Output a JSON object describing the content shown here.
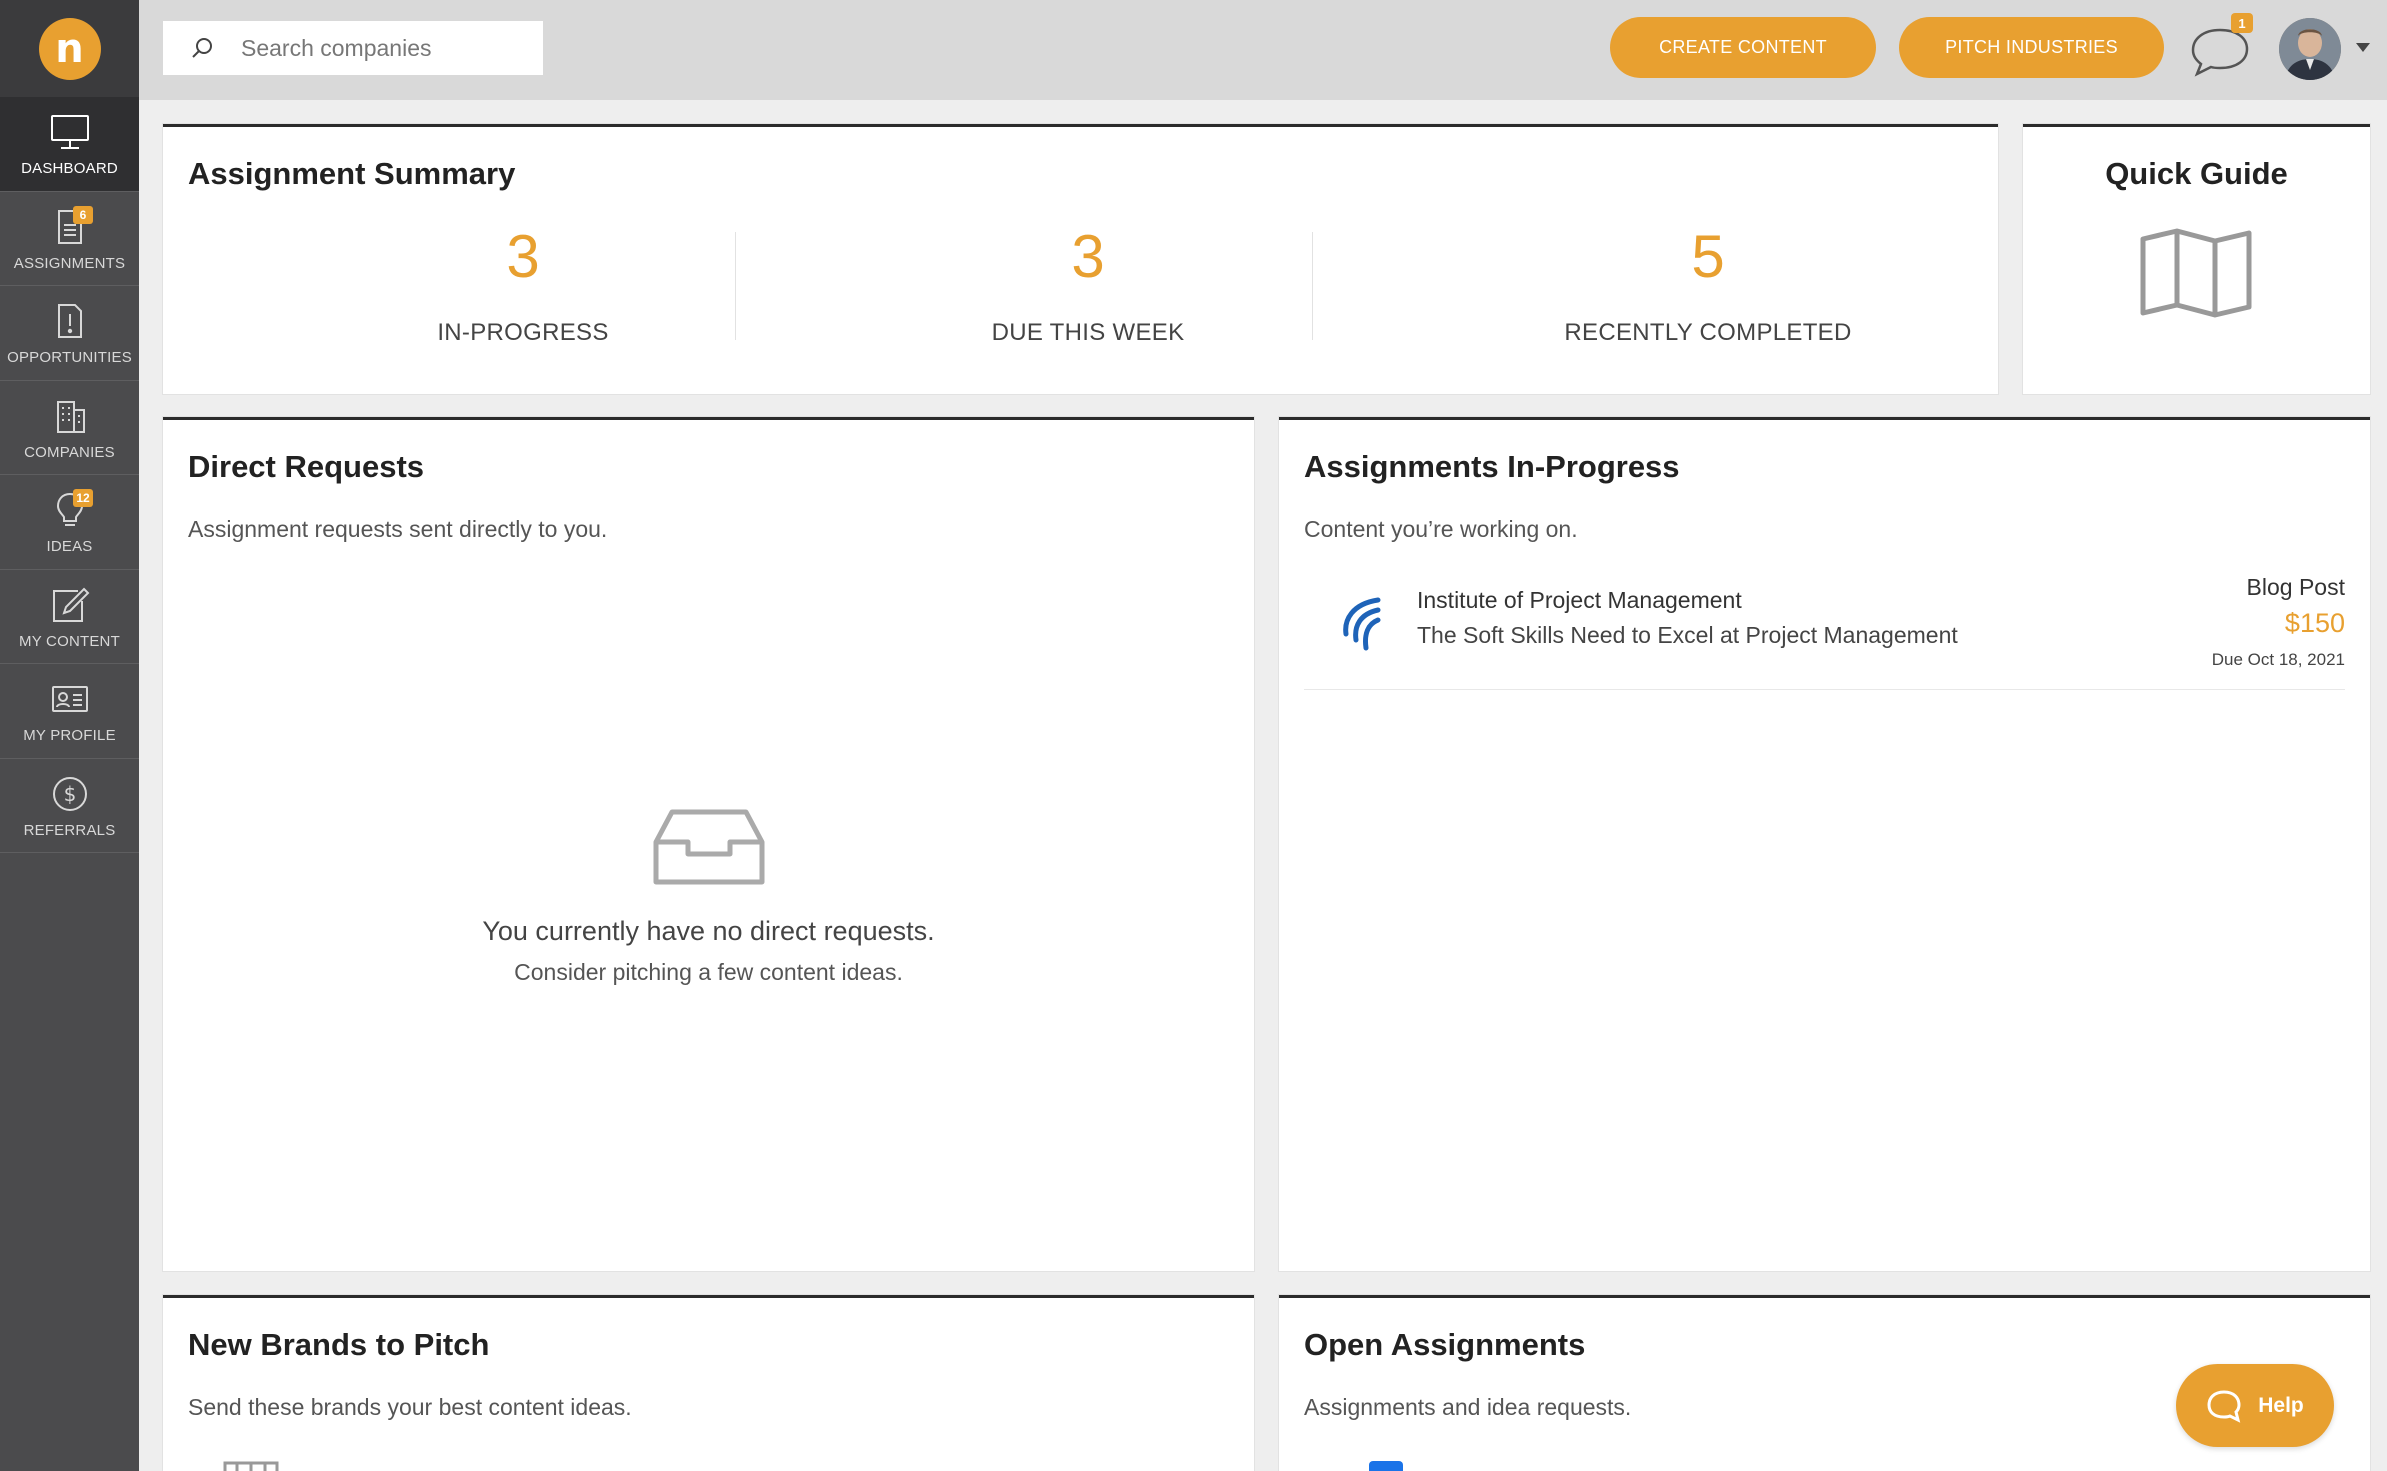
{
  "sidebar": {
    "logo_letter": "n",
    "items": [
      {
        "label": "DASHBOARD",
        "icon": "monitor-icon",
        "active": true
      },
      {
        "label": "ASSIGNMENTS",
        "icon": "document-list-icon",
        "badge": "6"
      },
      {
        "label": "OPPORTUNITIES",
        "icon": "document-alert-icon"
      },
      {
        "label": "COMPANIES",
        "icon": "building-icon"
      },
      {
        "label": "IDEAS",
        "icon": "lightbulb-icon",
        "badge": "12"
      },
      {
        "label": "MY CONTENT",
        "icon": "edit-icon"
      },
      {
        "label": "MY PROFILE",
        "icon": "id-card-icon"
      },
      {
        "label": "REFERRALS",
        "icon": "dollar-circle-icon"
      }
    ]
  },
  "topbar": {
    "search_placeholder": "Search companies",
    "create_label": "CREATE CONTENT",
    "pitch_label": "PITCH INDUSTRIES",
    "chat_badge": "1"
  },
  "summary": {
    "title": "Assignment Summary",
    "stats": [
      {
        "value": "3",
        "label": "IN-PROGRESS"
      },
      {
        "value": "3",
        "label": "DUE THIS WEEK"
      },
      {
        "value": "5",
        "label": "RECENTLY COMPLETED"
      }
    ]
  },
  "quick_guide": {
    "title": "Quick Guide"
  },
  "direct_requests": {
    "title": "Direct Requests",
    "subtitle": "Assignment requests sent directly to you.",
    "empty_main": "You currently have no direct requests.",
    "empty_sub": "Consider pitching a few content ideas."
  },
  "in_progress": {
    "title": "Assignments In-Progress",
    "subtitle": "Content you’re working on.",
    "items": [
      {
        "company": "Institute of Project Management",
        "name": "The Soft Skills Need to Excel at Project Management",
        "type": "Blog Post",
        "price": "$150",
        "due": "Due Oct 18, 2021"
      }
    ]
  },
  "new_brands": {
    "title": "New Brands to Pitch",
    "subtitle": "Send these brands your best content ideas."
  },
  "open_assignments": {
    "title": "Open Assignments",
    "subtitle": "Assignments and idea requests."
  },
  "help": {
    "label": "Help"
  },
  "colors": {
    "accent": "#e8a030",
    "sidebar": "#4b4b4d",
    "topbar": "#d9d9d9"
  }
}
